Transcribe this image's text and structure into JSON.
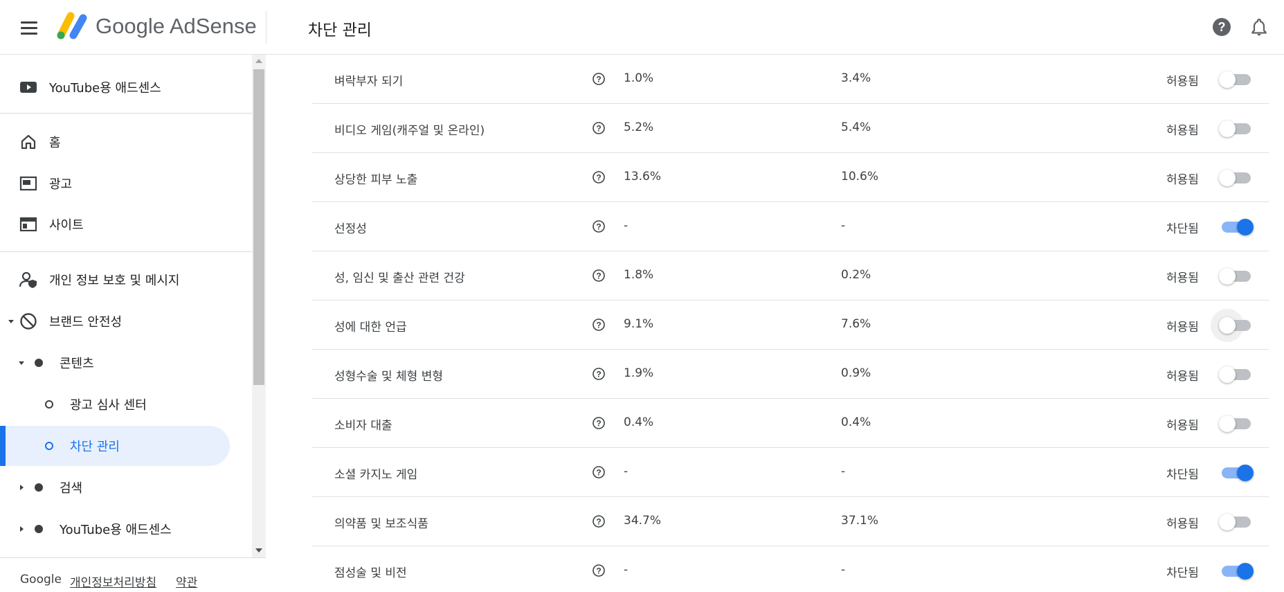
{
  "header": {
    "brand": "Google AdSense",
    "page_title": "차단 관리"
  },
  "sidebar": {
    "youtube_top": "YouTube용 애드센스",
    "home": "홈",
    "ads": "광고",
    "sites": "사이트",
    "privacy": "개인 정보 보호 및 메시지",
    "brand_safety": "브랜드 안전성",
    "content": "콘텐츠",
    "ad_review": "광고 심사 센터",
    "block_mgmt": "차단 관리",
    "search": "검색",
    "youtube_bottom": "YouTube용 애드센스"
  },
  "footer": {
    "google": "Google",
    "privacy_link": "개인정보처리방침",
    "terms_link": "약관"
  },
  "rows": [
    {
      "category": "벼락부자 되기",
      "v1": "1.0%",
      "v2": "3.4%",
      "status": "허용됨",
      "blocked": false
    },
    {
      "category": "비디오 게임(캐주얼 및 온라인)",
      "v1": "5.2%",
      "v2": "5.4%",
      "status": "허용됨",
      "blocked": false
    },
    {
      "category": "상당한 피부 노출",
      "v1": "13.6%",
      "v2": "10.6%",
      "status": "허용됨",
      "blocked": false
    },
    {
      "category": "선정성",
      "v1": "-",
      "v2": "-",
      "status": "차단됨",
      "blocked": true
    },
    {
      "category": "성, 임신 및 출산 관련 건강",
      "v1": "1.8%",
      "v2": "0.2%",
      "status": "허용됨",
      "blocked": false
    },
    {
      "category": "성에 대한 언급",
      "v1": "9.1%",
      "v2": "7.6%",
      "status": "허용됨",
      "blocked": false
    },
    {
      "category": "성형수술 및 체형 변형",
      "v1": "1.9%",
      "v2": "0.9%",
      "status": "허용됨",
      "blocked": false
    },
    {
      "category": "소비자 대출",
      "v1": "0.4%",
      "v2": "0.4%",
      "status": "허용됨",
      "blocked": false
    },
    {
      "category": "소셜 카지노 게임",
      "v1": "-",
      "v2": "-",
      "status": "차단됨",
      "blocked": true
    },
    {
      "category": "의약품 및 보조식품",
      "v1": "34.7%",
      "v2": "37.1%",
      "status": "허용됨",
      "blocked": false
    },
    {
      "category": "점성술 및 비전",
      "v1": "-",
      "v2": "-",
      "status": "차단됨",
      "blocked": true
    }
  ],
  "colors": {
    "accent": "#1a73e8",
    "active_bg": "#e8f0fe",
    "toggle_on_track": "#8ab4f8",
    "toggle_off_track": "#bdc1c6"
  },
  "icons": {
    "menu": "menu-icon",
    "help": "help-icon",
    "notifications": "bell-icon",
    "youtube": "youtube-icon",
    "home": "home-icon",
    "ads": "ads-icon",
    "sites": "sites-icon",
    "privacy": "person-shield-icon",
    "brand_safety": "block-icon",
    "row_help": "question-icon"
  }
}
